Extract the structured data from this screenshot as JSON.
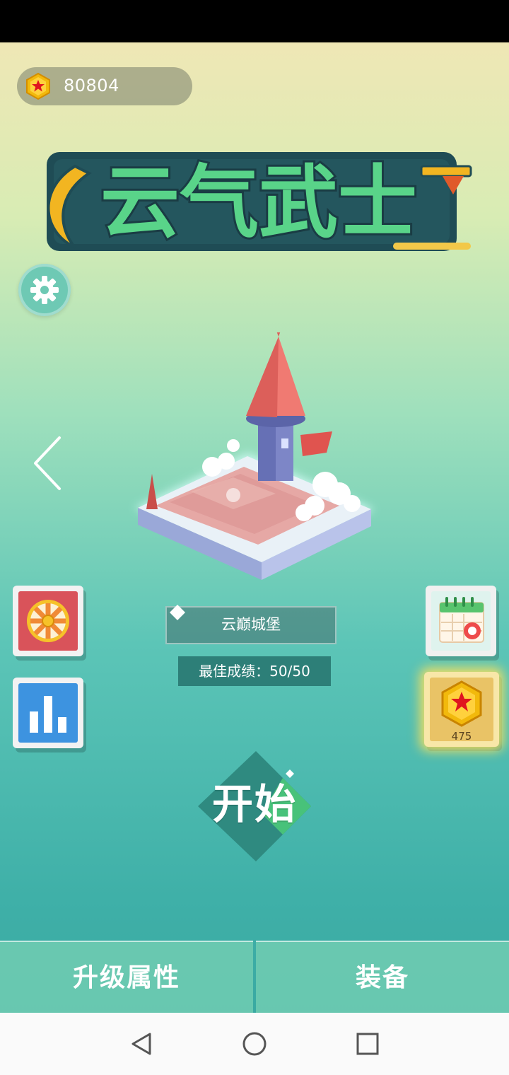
{
  "currency": {
    "amount": "80804",
    "icon": "gold-hexagon-star-coin"
  },
  "logo": {
    "title": "云气武士"
  },
  "level": {
    "name": "云巅城堡",
    "best_score": "最佳成绩：50/50"
  },
  "actions": {
    "start_label": "开始",
    "reward_count": "475"
  },
  "bottom_tabs": [
    {
      "label": "升级属性"
    },
    {
      "label": "装备"
    }
  ],
  "icons": {
    "settings": "gear-icon",
    "prev": "chevron-left-icon",
    "wheel": "lucky-wheel-icon",
    "leaderboard": "bar-chart-icon",
    "calendar": "calendar-icon",
    "reward": "coin-reward-icon"
  },
  "colors": {
    "accent": "#3aa9a2",
    "gold": "#f5c21b",
    "tower_roof": "#ec6b63"
  }
}
